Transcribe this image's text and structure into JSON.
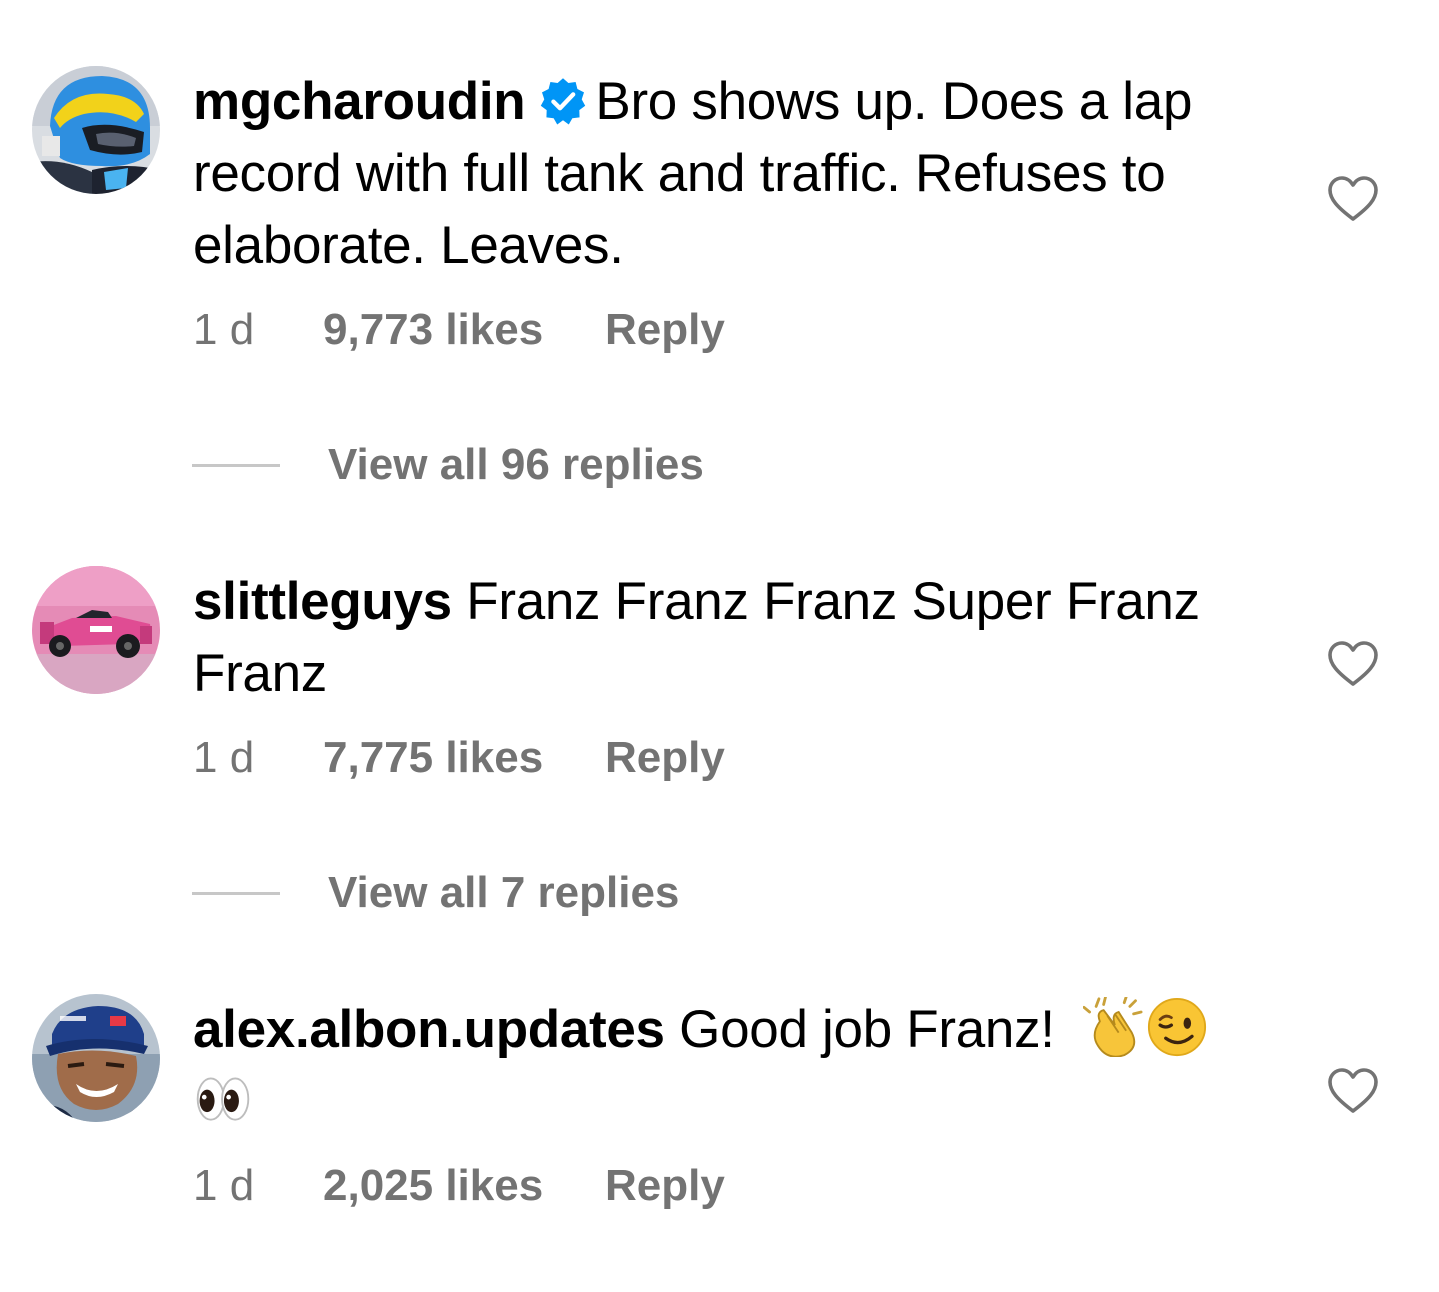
{
  "comments": [
    {
      "username": "mgcharoudin",
      "verified": true,
      "text": "Bro shows up. Does a lap record with full tank and traffic. Refuses to elaborate. Leaves.",
      "time": "1 d",
      "likes": "9,773 likes",
      "reply_label": "Reply",
      "view_replies": "View all 96 replies",
      "avatar_icon": "racing-helmet-avatar"
    },
    {
      "username": "slittleguys",
      "verified": false,
      "text": "Franz Franz Franz Super Franz Franz",
      "time": "1 d",
      "likes": "7,775 likes",
      "reply_label": "Reply",
      "view_replies": "View all 7 replies",
      "avatar_icon": "pink-race-car-avatar"
    },
    {
      "username": "alex.albon.updates",
      "verified": false,
      "text": "Good job Franz!",
      "emojis": [
        "clapping-hands-emoji",
        "winking-face-emoji",
        "eyes-emoji"
      ],
      "time": "1 d",
      "likes": "2,025 likes",
      "reply_label": "Reply",
      "avatar_icon": "driver-in-cap-avatar"
    }
  ],
  "colors": {
    "text": "#000000",
    "secondary": "#737373",
    "divider": "#c7c7c7",
    "verified_blue": "#0095f6"
  }
}
